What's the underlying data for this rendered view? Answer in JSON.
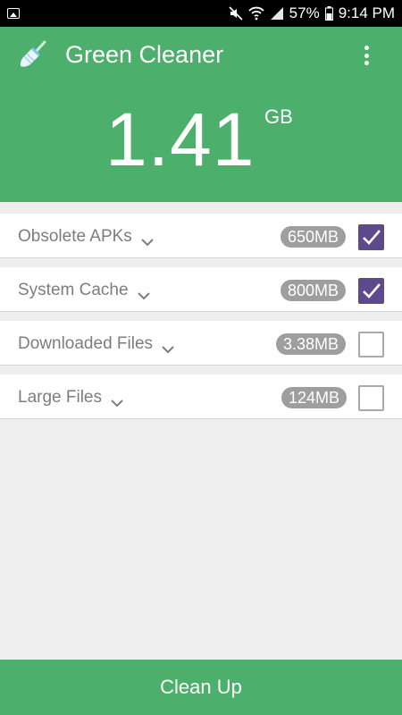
{
  "status_bar": {
    "battery": "57%",
    "time": "9:14 PM",
    "icons": [
      "gallery-icon",
      "mute-icon",
      "wifi-icon",
      "signal-icon",
      "battery-icon"
    ]
  },
  "app": {
    "title": "Green Cleaner",
    "colors": {
      "primary": "#4caf6b",
      "checkbox_checked": "#5c4a8c",
      "badge": "#9e9e9e"
    }
  },
  "summary": {
    "total": "1.41",
    "unit": "GB"
  },
  "items": [
    {
      "label": "Obsolete APKs",
      "size": "650MB",
      "checked": true
    },
    {
      "label": "System Cache",
      "size": "800MB",
      "checked": true
    },
    {
      "label": "Downloaded Files",
      "size": "3.38MB",
      "checked": false
    },
    {
      "label": "Large Files",
      "size": "124MB",
      "checked": false
    }
  ],
  "actions": {
    "clean_label": "Clean Up"
  }
}
